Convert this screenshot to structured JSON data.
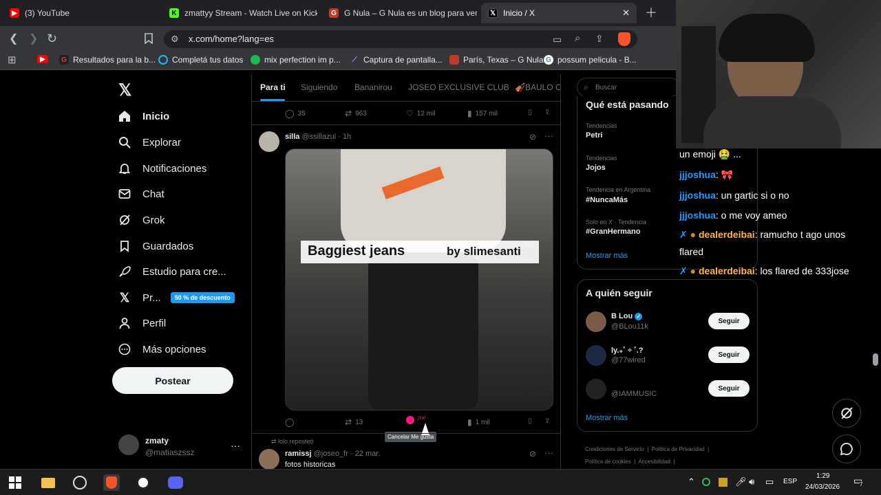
{
  "browser": {
    "tabs": [
      {
        "title": "(3) YouTube",
        "icon": "youtube-icon",
        "color": "#ff0000"
      },
      {
        "title": "zmattyy Stream - Watch Live on Kick",
        "icon": "kick-icon",
        "color": "#53fc18"
      },
      {
        "title": "G Nula – G Nula es un blog para ver",
        "icon": "gnula-icon",
        "color": "#c0392b"
      },
      {
        "title": "Inicio / X",
        "icon": "x-logo-icon",
        "color": "#ffffff"
      }
    ],
    "url": "x.com/home?lang=es",
    "bookmarks": [
      {
        "label": "",
        "icon": "youtube-icon"
      },
      {
        "label": "Resultados para la b...",
        "icon": "gnula-g-icon"
      },
      {
        "label": "Completá tus datos",
        "icon": "circle-icon"
      },
      {
        "label": "mix perfection im p...",
        "icon": "spotify-icon"
      },
      {
        "label": "Captura de pantalla...",
        "icon": "feather-icon"
      },
      {
        "label": "París, Texas – G Nula",
        "icon": "gnula-icon"
      },
      {
        "label": "possum pelicula - B...",
        "icon": "google-icon"
      }
    ]
  },
  "x": {
    "nav": [
      {
        "label": "Inicio",
        "icon": "home-icon",
        "bold": true
      },
      {
        "label": "Explorar",
        "icon": "search-icon"
      },
      {
        "label": "Notificaciones",
        "icon": "bell-icon"
      },
      {
        "label": "Chat",
        "icon": "mail-icon"
      },
      {
        "label": "Grok",
        "icon": "grok-icon"
      },
      {
        "label": "Guardados",
        "icon": "bookmark-icon"
      },
      {
        "label": "Estudio para cre...",
        "icon": "rocket-icon"
      },
      {
        "label": "Pr...",
        "icon": "x-logo-icon",
        "badge": "50 % de descuento"
      },
      {
        "label": "Perfil",
        "icon": "person-icon"
      },
      {
        "label": "Más opciones",
        "icon": "more-circle-icon"
      }
    ],
    "post_button": "Postear",
    "account": {
      "name": "zmaty",
      "handle": "@matiaszssz",
      "more": "···"
    },
    "feed_tabs": [
      "Para ti",
      "Siguiendo",
      "Bananirou",
      "JOSEO EXCLUSIVE CLUB",
      "🎻BAULO CL"
    ],
    "prev_actions": {
      "replies": "35",
      "reposts": "963",
      "likes": "12 mil",
      "views": "157 mil"
    },
    "post": {
      "author": "silla",
      "handle": "@ssillazul",
      "time": "· 1h",
      "media_caption_1": "Baggiest jeans",
      "media_caption_2": "by slimesanti",
      "reposts": "13",
      "like_text": "¡Ya!",
      "views": "1 mil",
      "tooltip": "Cancelar Me gusta"
    },
    "next_post": {
      "reposted_by": "lolo reposteó",
      "author": "ramissj",
      "handle": "@joseo_fr",
      "time": "· 22 mar.",
      "text": "fotos historicas"
    },
    "search_placeholder": "Buscar",
    "trends_title": "Qué está pasando",
    "trends": [
      {
        "category": "Tendencias",
        "name": "Petri"
      },
      {
        "category": "Tendencias",
        "name": "Jojos"
      },
      {
        "category": "Tendencia en Argentina",
        "name": "#NuncaMás"
      },
      {
        "category": "Solo en X · Tendencia",
        "name": "#GranHermano"
      }
    ],
    "show_more": "Mostrar más",
    "who_to_follow_title": "A quién seguir",
    "who_to_follow": [
      {
        "name": "B Lou",
        "handle": "@BLou11k",
        "verified": true
      },
      {
        "name": "ly.₊˚ ÷ ˚.?",
        "handle": "@77wired"
      },
      {
        "name": "",
        "handle": "@IAMMUSIC"
      }
    ],
    "follow_label": "Seguir",
    "footer": [
      "Condiciones de Servicio",
      "Política de Privacidad",
      "Política de cookies",
      "Accesibilidad"
    ]
  },
  "chat": [
    {
      "user": "",
      "text": "un emoji 🤮 ..."
    },
    {
      "user": "jjjoshua",
      "text": ": 🎀"
    },
    {
      "user": "jjjoshua",
      "text": ": un gartic si o no"
    },
    {
      "user": "jjjoshua",
      "text": ": o me voy ameo"
    },
    {
      "user": "dealerdeibai",
      "text": ": ramucho t ago unos"
    },
    {
      "user": "",
      "text": "flared"
    },
    {
      "user": "dealerdeibai",
      "text": ": los flared de 333jose"
    }
  ],
  "taskbar": {
    "language": "ESP",
    "time": "1:29",
    "date": "24/03/2026",
    "notifications": "7"
  }
}
